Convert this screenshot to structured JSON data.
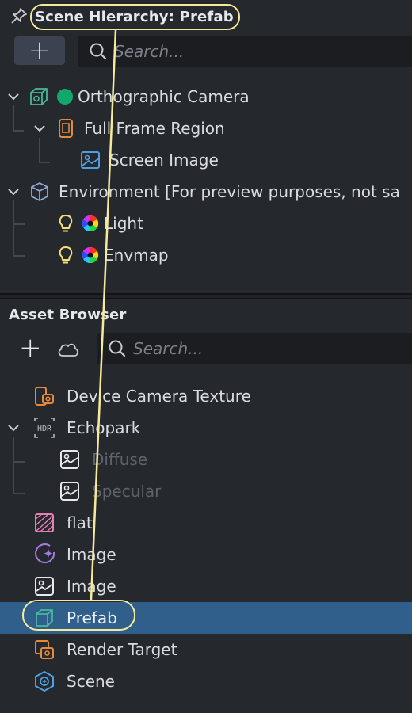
{
  "scene_hierarchy": {
    "title": "Scene Hierarchy: Prefab",
    "add_label": "+",
    "search_placeholder": "Search...",
    "items": [
      {
        "label": "Orthographic Camera",
        "icon": "camera-cube-icon",
        "status_icon": "green-dot-icon"
      },
      {
        "label": "Full Frame Region",
        "icon": "phone-region-icon"
      },
      {
        "label": "Screen Image",
        "icon": "screen-image-icon"
      },
      {
        "label": "Environment [For preview purposes, not sa",
        "icon": "environment-cube-icon"
      },
      {
        "label": "Light",
        "icon": "light-bulb-icon"
      },
      {
        "label": "Envmap",
        "icon": "light-bulb-icon"
      }
    ]
  },
  "asset_browser": {
    "title": "Asset Browser",
    "add_label": "+",
    "search_placeholder": "Search...",
    "items": [
      {
        "label": "Device Camera Texture",
        "icon": "device-camera-texture-icon"
      },
      {
        "label": "Echopark",
        "icon": "hdr-icon"
      },
      {
        "label": "Diffuse",
        "icon": "image-icon"
      },
      {
        "label": "Specular",
        "icon": "image-icon"
      },
      {
        "label": "flat",
        "icon": "flat-texture-icon"
      },
      {
        "label": "Image",
        "icon": "sparkle-image-icon"
      },
      {
        "label": "Image",
        "icon": "image-icon"
      },
      {
        "label": "Prefab",
        "icon": "prefab-cube-icon"
      },
      {
        "label": "Render Target",
        "icon": "render-target-icon"
      },
      {
        "label": "Scene",
        "icon": "scene-icon"
      }
    ]
  },
  "colors": {
    "highlight": "#f4ea9a",
    "selection": "#2f5f8a",
    "orange": "#e58a3a",
    "blue": "#4f9fe0",
    "teal": "#48b89a",
    "yellow": "#f2e27a"
  }
}
